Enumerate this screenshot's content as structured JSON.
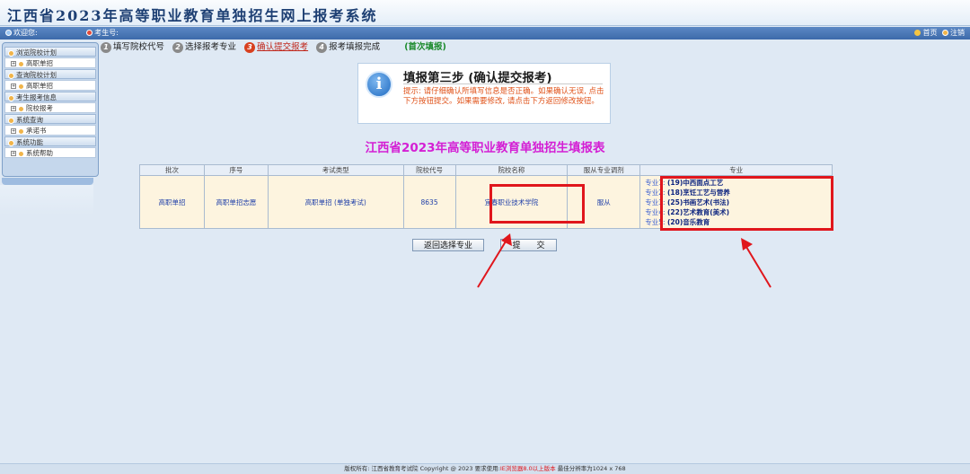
{
  "header": {
    "title": "江西省2023年高等职业教育单独招生网上报考系统"
  },
  "infobar": {
    "welcome": "欢迎您:",
    "exam_no": "考生号:",
    "home": "首页",
    "logout": "注销"
  },
  "sidebar": {
    "groups": [
      {
        "label": "浏览院校计划",
        "item": "高职单招"
      },
      {
        "label": "查询院校计划",
        "item": "高职单招"
      },
      {
        "label": "考生报考信息",
        "item": "院校报考"
      },
      {
        "label": "系统查询",
        "item": "承诺书"
      },
      {
        "label": "系统功能",
        "item": "系统帮助"
      }
    ]
  },
  "steps": [
    {
      "num": "1",
      "label": "填写院校代号"
    },
    {
      "num": "2",
      "label": "选择报考专业"
    },
    {
      "num": "3",
      "label": "确认提交报考"
    },
    {
      "num": "4",
      "label": "报考填报完成"
    },
    {
      "num": "",
      "label": "(首次填报)"
    }
  ],
  "notice": {
    "icon": "i",
    "title": "填报第三步 (确认提交报考)",
    "text": "提示: 请仔细确认所填写信息是否正确。如果确认无误, 点击下方按钮提交。如果需要修改, 请点击下方返回修改按钮。"
  },
  "table": {
    "title": "江西省2023年高等职业教育单独招生填报表",
    "headers": [
      "批次",
      "序号",
      "考试类型",
      "院校代号",
      "院校名称",
      "服从专业调剂",
      "专业"
    ],
    "row": {
      "batch": "高职单招",
      "seq": "高职单招志愿",
      "exam_type": "高职单招 (单独考试)",
      "school_code": "8635",
      "school_name": "宜春职业技术学院",
      "obey": "服从"
    },
    "majors": [
      {
        "label": "专业1:",
        "value": "(19)中西面点工艺"
      },
      {
        "label": "专业2:",
        "value": "(18)烹饪工艺与营养"
      },
      {
        "label": "专业3:",
        "value": "(25)书画艺术(书法)"
      },
      {
        "label": "专业4:",
        "value": "(22)艺术教育(美术)"
      },
      {
        "label": "专业5:",
        "value": "(20)音乐教育"
      }
    ]
  },
  "buttons": {
    "back": "返回选择专业",
    "submit": "提　　交"
  },
  "footer": {
    "text1": "版权所有: 江西省教育考试院 Copyright @ 2023 要求使用:",
    "highlight": "IE浏览器8.0以上版本",
    "text2": " 最佳分辨率为1024 x 768"
  },
  "colors": {
    "annotation": "#e0161c",
    "title_magenta": "#d41fd4",
    "step_active": "#c0281c"
  }
}
